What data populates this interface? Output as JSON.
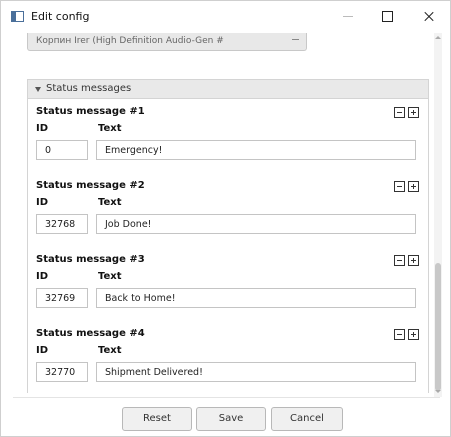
{
  "window": {
    "title": "Edit config",
    "icon": "app-window-icon"
  },
  "top_combo": {
    "value": "Корпин Irer (High Definition Audio-Gen #"
  },
  "status_group": {
    "label": "Status messages",
    "expanded": true,
    "id_label": "ID",
    "text_label": "Text",
    "messages": [
      {
        "title": "Status message #1",
        "id": "0",
        "text": "Emergency!"
      },
      {
        "title": "Status message #2",
        "id": "32768",
        "text": "Job Done!"
      },
      {
        "title": "Status message #3",
        "id": "32769",
        "text": "Back to Home!"
      },
      {
        "title": "Status message #4",
        "id": "32770",
        "text": "Shipment Delivered!"
      }
    ]
  },
  "footer": {
    "reset_label": "Reset",
    "save_label": "Save",
    "cancel_label": "Cancel"
  }
}
